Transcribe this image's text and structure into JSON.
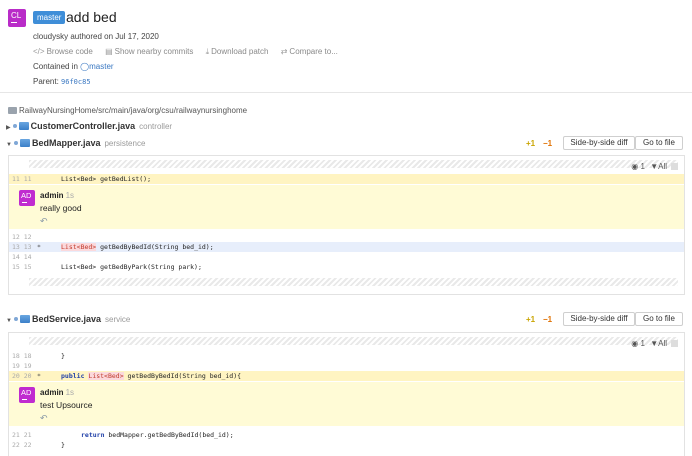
{
  "commit": {
    "avatar_initials": "CL",
    "branch_badge": "master",
    "title": "add bed",
    "authored": "cloudysky authored on Jul 17, 2020",
    "actions": {
      "browse": "Browse code",
      "nearby": "Show nearby commits",
      "download": "Download patch",
      "compare": "Compare to..."
    },
    "contained_label": "Contained in",
    "contained_branch": "master",
    "parent_label": "Parent:",
    "parent_hash": "96f0c85"
  },
  "path": "RailwayNursingHome/src/main/java/org/csu/railwaynursinghome",
  "files": [
    {
      "name": "CustomerController.java",
      "subtitle": "controller",
      "expanded": false
    },
    {
      "name": "BedMapper.java",
      "subtitle": "persistence",
      "expanded": true,
      "added": "+1",
      "removed": "−1",
      "side_by_side": "Side-by-side diff",
      "goto": "Go to file",
      "comments_count": "1",
      "filter": "All",
      "lines": [
        {
          "num": "11 11",
          "mark": "",
          "code": "List<Bed> getBedList();"
        },
        {
          "num": "12 12",
          "mark": "",
          "code": ""
        },
        {
          "num": "13 13",
          "mark": "*",
          "code_a": "List<Bed>",
          "code_b": " getBedByBedId(String bed_id);"
        },
        {
          "num": "14 14",
          "mark": "",
          "code": ""
        },
        {
          "num": "15 15",
          "mark": "",
          "code": "List<Bed> getBedByPark(String park);"
        }
      ],
      "comment": {
        "initials": "AD",
        "author": "admin",
        "time": "1s",
        "text": "really good"
      }
    },
    {
      "name": "BedService.java",
      "subtitle": "service",
      "expanded": true,
      "added": "+1",
      "removed": "−1",
      "side_by_side": "Side-by-side diff",
      "goto": "Go to file",
      "comments_count": "1",
      "filter": "All",
      "lines": [
        {
          "num": "18 18",
          "mark": "",
          "code": "}"
        },
        {
          "num": "19 19",
          "mark": "",
          "code": ""
        },
        {
          "num": "20 20",
          "mark": "*",
          "code_kw": "public",
          "code_a": "List<Bed>",
          "code_b": " getBedByBedId(String bed_id){"
        },
        {
          "num": "21 21",
          "mark": "",
          "code_kw": "return",
          "code": " bedMapper.getBedByBedId(bed_id);"
        },
        {
          "num": "22 22",
          "mark": "",
          "code": "}"
        }
      ],
      "comment": {
        "initials": "AD",
        "author": "admin",
        "time": "1s",
        "text": "test Upsource"
      }
    }
  ],
  "icons": {
    "browse": "code-icon",
    "nearby": "commits-icon",
    "download": "download-icon",
    "compare": "compare-icon",
    "branch": "branch-icon",
    "reply": "reply-icon",
    "comment": "comment-bubble-icon",
    "filter": "filter-icon"
  },
  "colors": {
    "accent": "#3f8ed8",
    "avatar": "#b92cc8",
    "added": "#c9a400",
    "removed": "#e07000",
    "comment_bg": "#fffbd6"
  }
}
